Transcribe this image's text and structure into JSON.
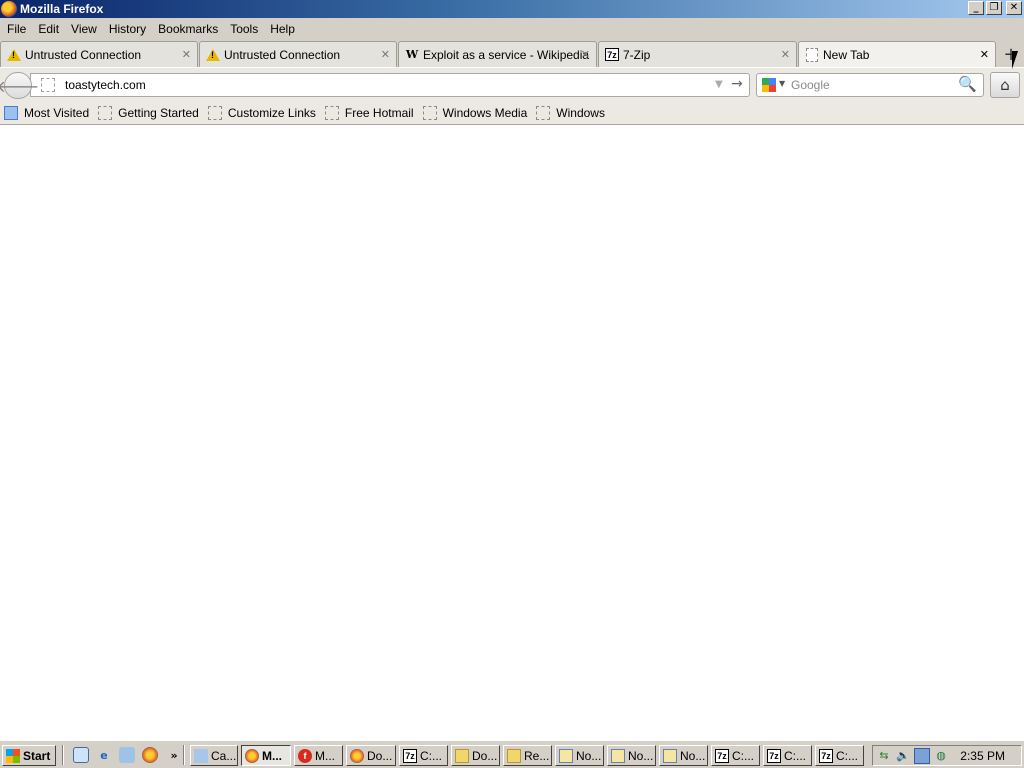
{
  "window": {
    "title": "Mozilla Firefox"
  },
  "menu": [
    "File",
    "Edit",
    "View",
    "History",
    "Bookmarks",
    "Tools",
    "Help"
  ],
  "tabs": [
    {
      "title": "Untrusted Connection",
      "icon": "warning-icon"
    },
    {
      "title": "Untrusted Connection",
      "icon": "warning-icon"
    },
    {
      "title": "Exploit as a service - Wikipedia",
      "icon": "wikipedia-icon"
    },
    {
      "title": "7-Zip",
      "icon": "7zip-icon"
    },
    {
      "title": "New Tab",
      "icon": "blank-page-icon",
      "active": true
    }
  ],
  "navbar": {
    "url": "toastytech.com",
    "search_placeholder": "Google"
  },
  "bookmarks": [
    "Most Visited",
    "Getting Started",
    "Customize Links",
    "Free Hotmail",
    "Windows Media",
    "Windows"
  ],
  "taskbar": {
    "start_label": "Start",
    "buttons": [
      "Ca...",
      "M...",
      "M...",
      "Do...",
      "C:...",
      "Do...",
      "Re...",
      "No...",
      "No...",
      "No...",
      "C:...",
      "C:...",
      "C:..."
    ],
    "clock": "2:35 PM"
  },
  "icons": {
    "tab_close": "✕",
    "new_tab": "+",
    "back": "🡐",
    "go": "→",
    "dropdown": "▼",
    "search": "🔍",
    "home": "⌂"
  },
  "colors": {
    "titlebar_start": "#0a246a",
    "titlebar_end": "#a6caf0",
    "chrome": "#d4d0c8"
  }
}
